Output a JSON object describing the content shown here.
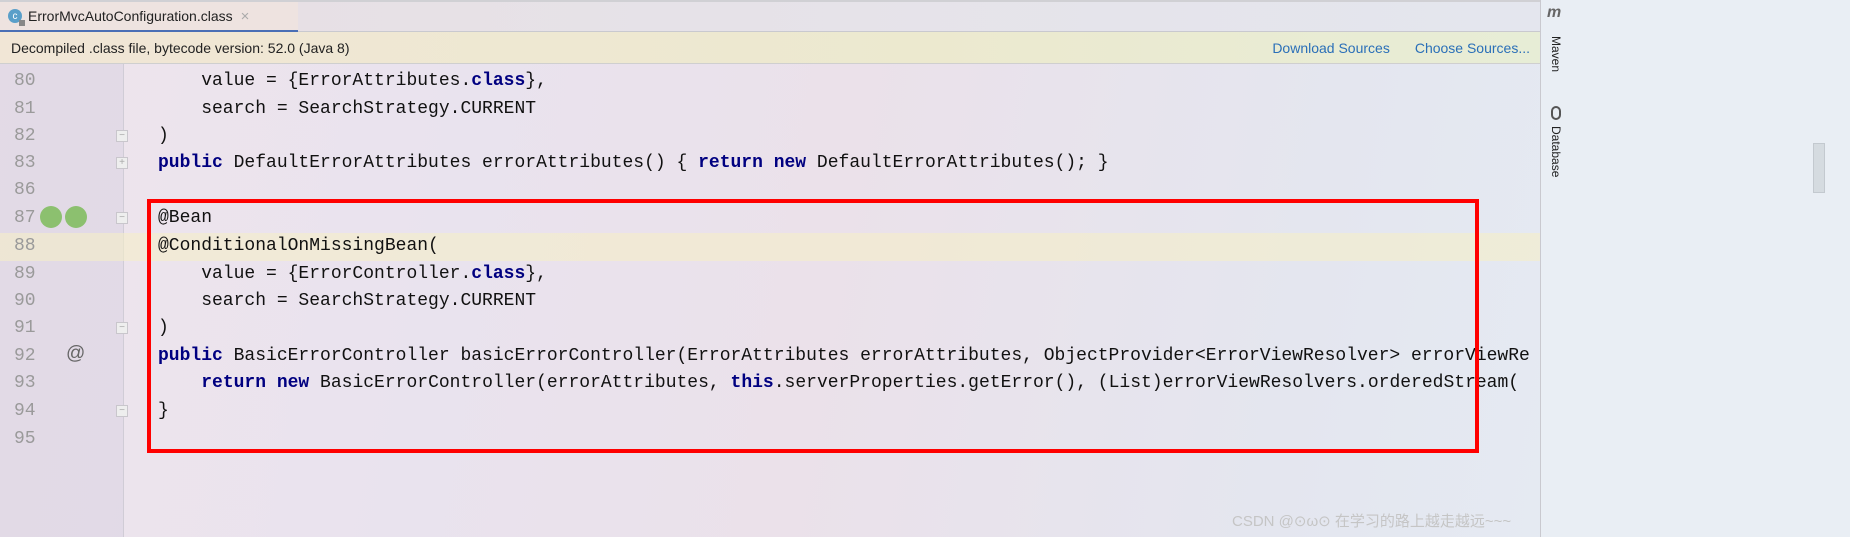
{
  "tab": {
    "title": "ErrorMvcAutoConfiguration.class",
    "icon": "class-file-icon"
  },
  "notice": {
    "text": "Decompiled .class file, bytecode version: 52.0 (Java 8)",
    "download": "Download Sources",
    "choose": "Choose Sources..."
  },
  "sidebar": {
    "maven": "Maven",
    "database": "Database"
  },
  "lines": [
    {
      "n": "80",
      "tokens": [
        [
          "    value = {ErrorAttributes.",
          ""
        ],
        [
          "class",
          "kw"
        ],
        [
          "},",
          ""
        ]
      ]
    },
    {
      "n": "81",
      "tokens": [
        [
          "    search = SearchStrategy.CURRENT",
          ""
        ]
      ]
    },
    {
      "n": "82",
      "tokens": [
        [
          ")",
          ""
        ]
      ]
    },
    {
      "n": "83",
      "tokens": [
        [
          "public",
          "kw"
        ],
        [
          " DefaultErrorAttributes errorAttributes() { ",
          ""
        ],
        [
          "return new",
          "kw"
        ],
        [
          " DefaultErrorAttributes(); }",
          ""
        ]
      ]
    },
    {
      "n": "86",
      "tokens": []
    },
    {
      "n": "87",
      "tokens": [
        [
          "@Bean",
          ""
        ]
      ]
    },
    {
      "n": "88",
      "tokens": [
        [
          "@ConditionalOnMissingBean(",
          ""
        ]
      ]
    },
    {
      "n": "89",
      "tokens": [
        [
          "    value = {ErrorController.",
          ""
        ],
        [
          "class",
          "kw"
        ],
        [
          "},",
          ""
        ]
      ]
    },
    {
      "n": "90",
      "tokens": [
        [
          "    search = SearchStrategy.CURRENT",
          ""
        ]
      ]
    },
    {
      "n": "91",
      "tokens": [
        [
          ")",
          ""
        ]
      ]
    },
    {
      "n": "92",
      "tokens": [
        [
          "public",
          "kw"
        ],
        [
          " BasicErrorController basicErrorController(ErrorAttributes errorAttributes, ObjectProvider<ErrorViewResolver> errorViewRe",
          ""
        ]
      ]
    },
    {
      "n": "93",
      "tokens": [
        [
          "    ",
          ""
        ],
        [
          "return new",
          "kw"
        ],
        [
          " BasicErrorController(errorAttributes, ",
          ""
        ],
        [
          "this",
          "kw"
        ],
        [
          ".serverProperties.getError(), (List)errorViewResolvers.orderedStream(",
          ""
        ]
      ]
    },
    {
      "n": "94",
      "tokens": [
        [
          "}",
          ""
        ]
      ]
    },
    {
      "n": "95",
      "tokens": []
    }
  ],
  "gutter": {
    "at_symbol": "@"
  },
  "watermark": "CSDN @⊙ω⊙ 在学习的路上越走越远~~~"
}
